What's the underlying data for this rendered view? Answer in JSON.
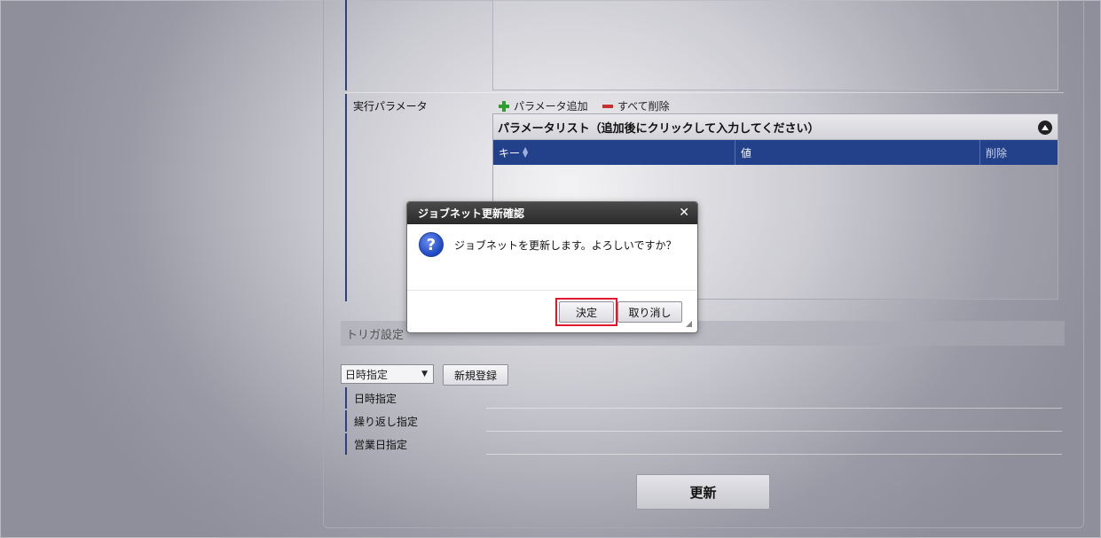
{
  "form": {
    "exec_params_label": "実行パラメータ",
    "add_param_label": "パラメータ追加",
    "delete_all_label": "すべて削除",
    "param_list_title": "パラメータリスト（追加後にクリックして入力してください）",
    "grid_columns": [
      "キー",
      "値",
      "削除"
    ]
  },
  "trigger": {
    "section_title": "トリガ設定",
    "select_value": "日時指定",
    "new_register_label": "新規登録",
    "rows": [
      "日時指定",
      "繰り返し指定",
      "営業日指定"
    ]
  },
  "update_label": "更新",
  "dialog": {
    "title": "ジョブネット更新確認",
    "message": "ジョブネットを更新します。よろしいですか？",
    "ok_label": "決定",
    "cancel_label": "取り消し"
  }
}
